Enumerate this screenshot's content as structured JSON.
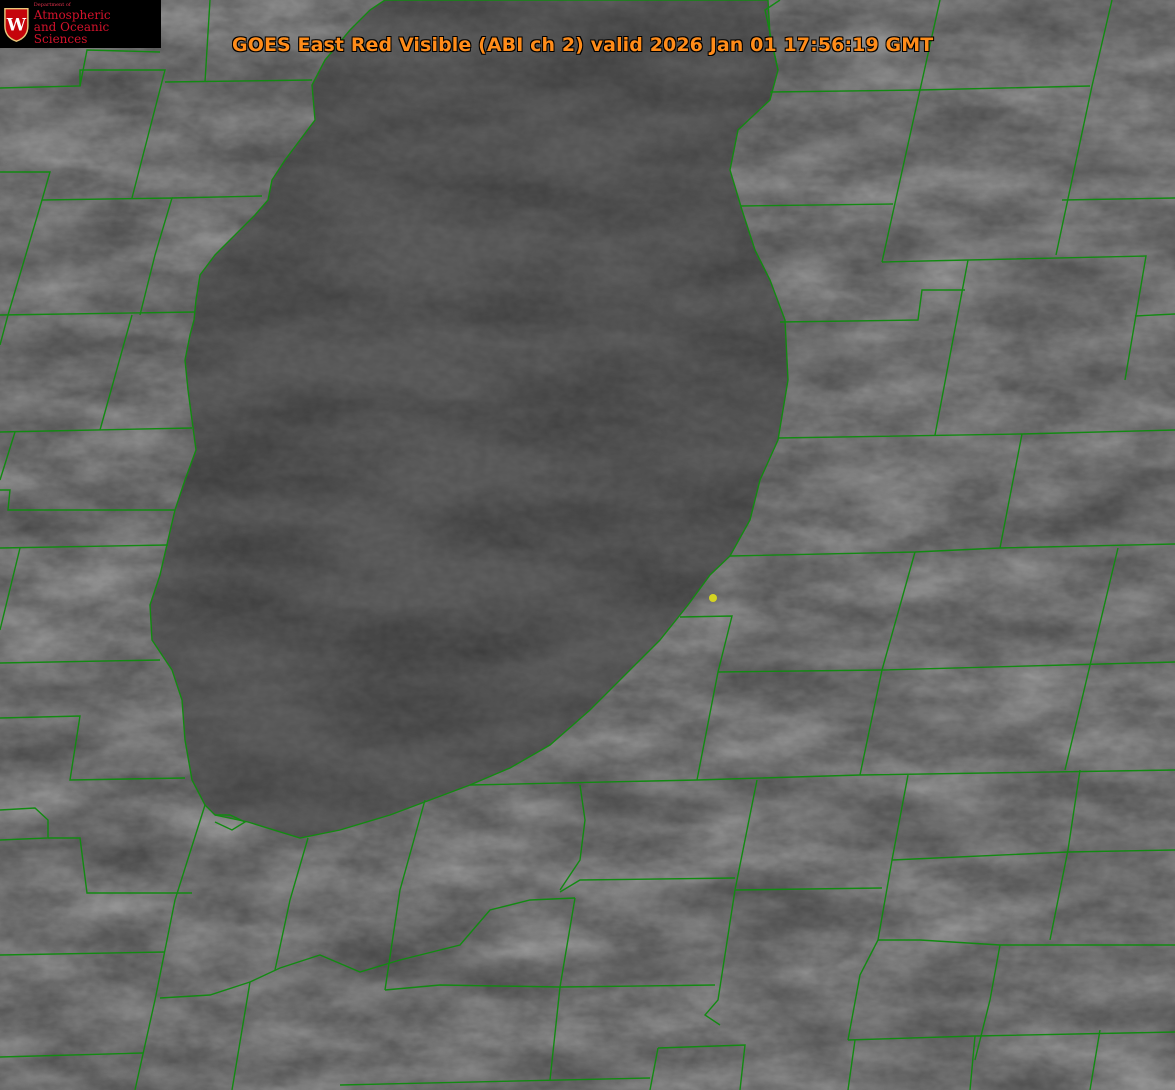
{
  "title": "GOES East Red Visible (ABI ch 2) valid 2026 Jan 01 17:56:19 GMT",
  "logo": {
    "department": "Department of",
    "line1": "Atmospheric",
    "line2": "and Oceanic Sciences",
    "seal_letter": "W"
  },
  "colors": {
    "boundary": "#128a12",
    "coastline": "#d03030",
    "marker": "#d4d422",
    "title": "#ff8c1a",
    "logo_red": "#d3122b"
  },
  "icons": [
    "uw-seal-icon",
    "location-marker-icon"
  ]
}
